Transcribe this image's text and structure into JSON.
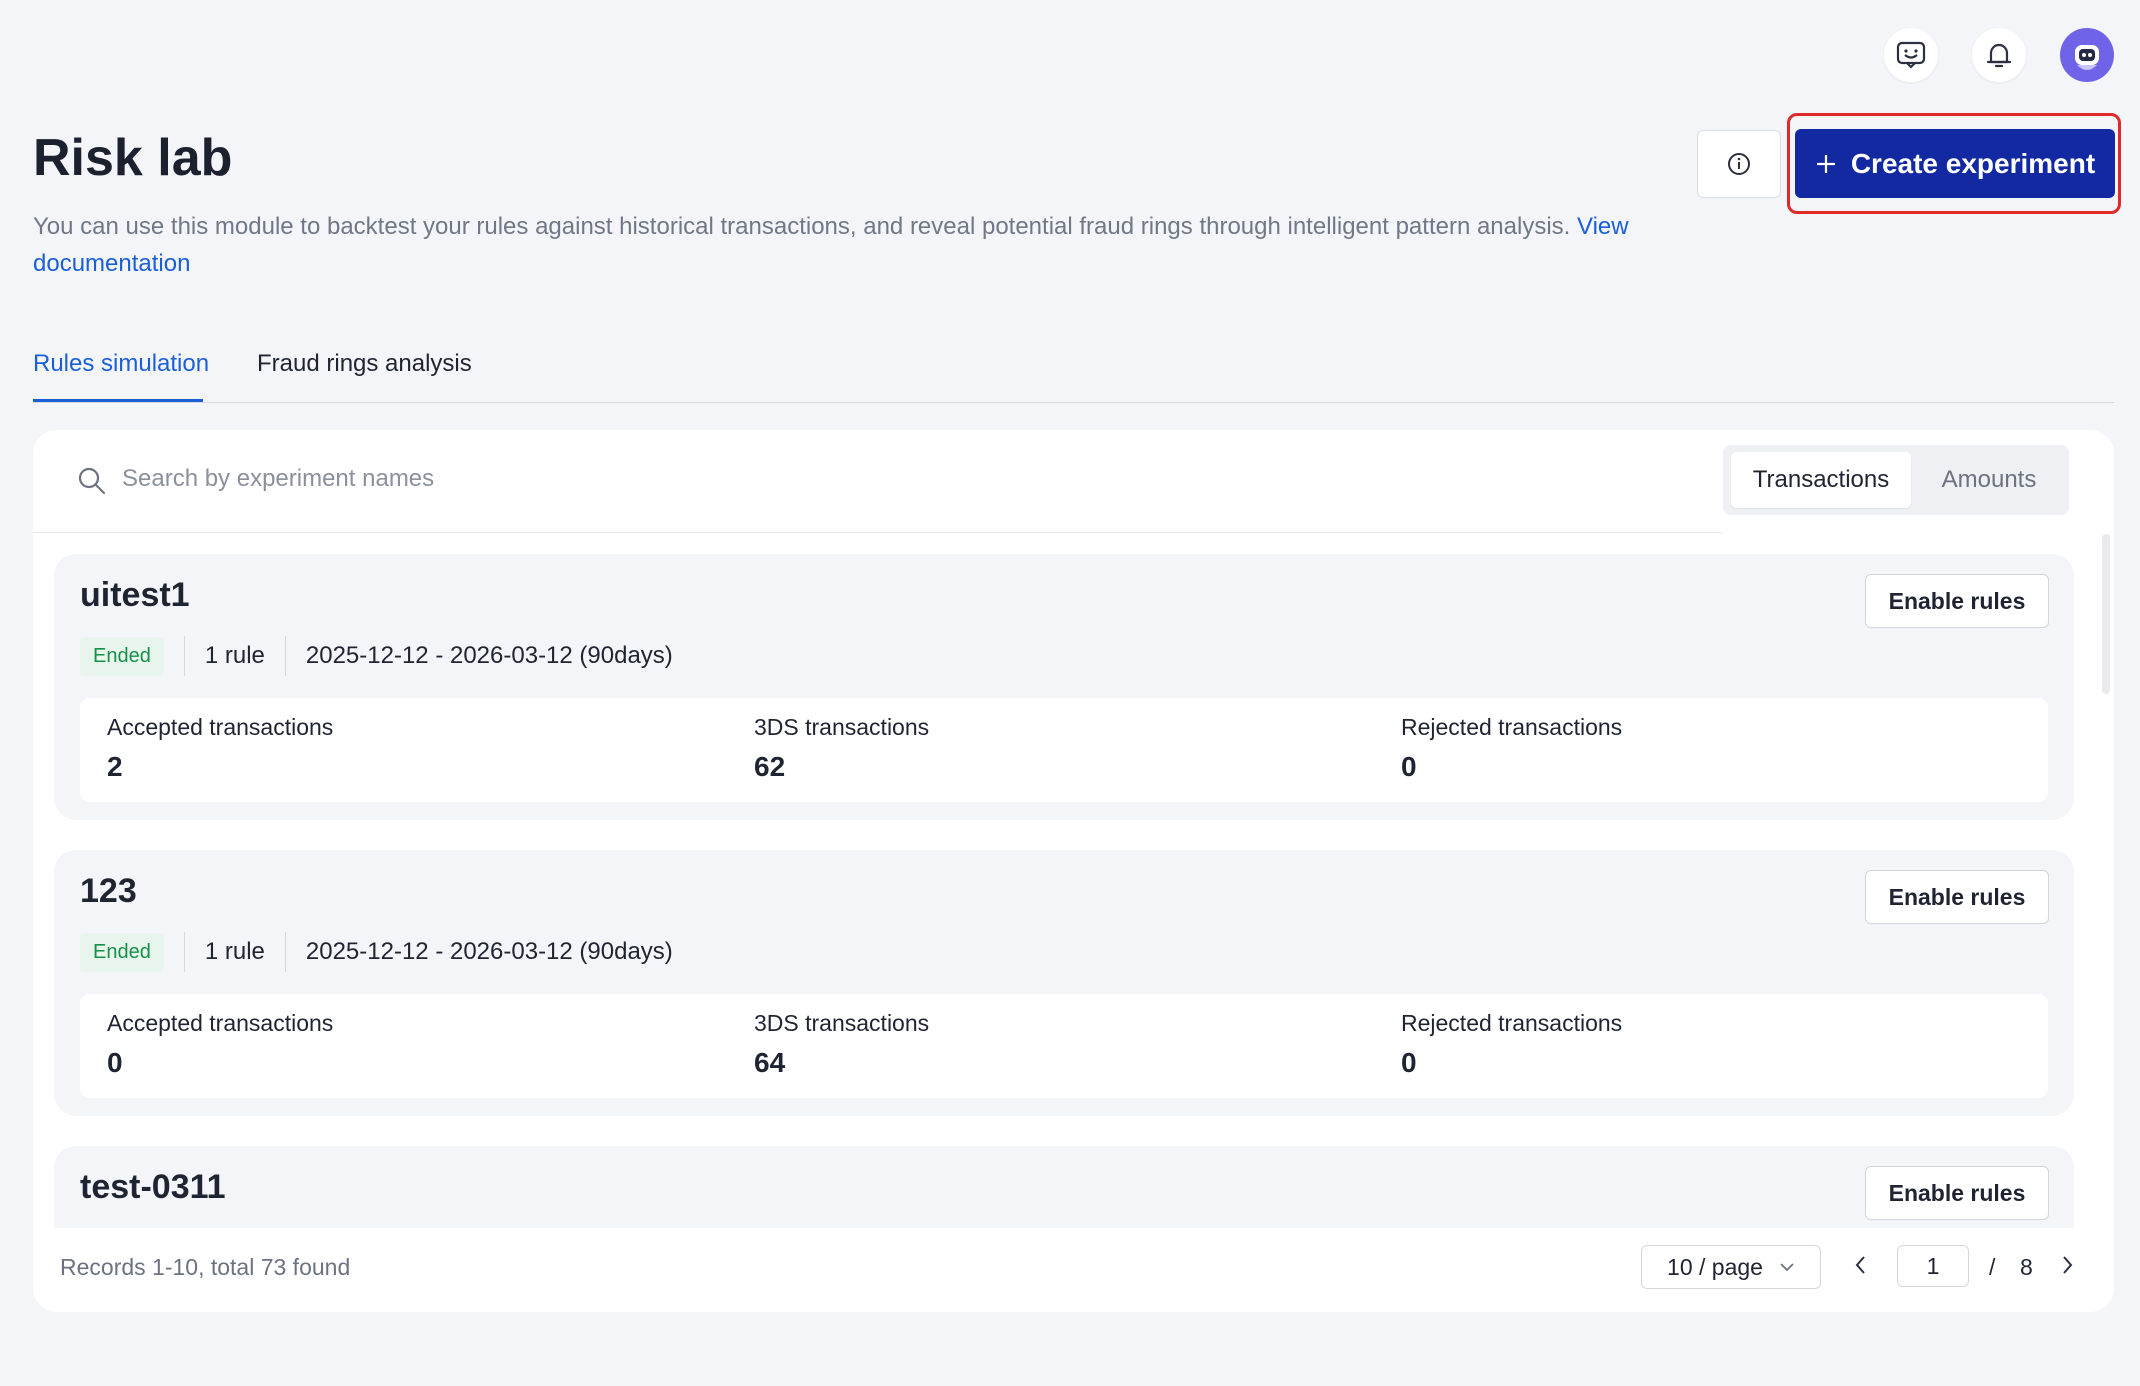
{
  "header": {
    "title": "Risk lab",
    "description": "You can use this module to backtest your rules against historical transactions, and reveal potential fraud rings through intelligent pattern analysis.",
    "doc_link": "View documentation",
    "create_button": "Create experiment",
    "icons": [
      "feedback-icon",
      "bell-icon",
      "avatar",
      "info-icon",
      "plus-icon"
    ]
  },
  "tabs": [
    {
      "label": "Rules simulation",
      "active": true
    },
    {
      "label": "Fraud rings analysis",
      "active": false
    }
  ],
  "search": {
    "placeholder": "Search by experiment names"
  },
  "view_toggle": {
    "options": [
      "Transactions",
      "Amounts"
    ],
    "selected": "Transactions"
  },
  "experiments": [
    {
      "name": "uitest1",
      "status": "Ended",
      "rules": "1 rule",
      "period": "2025-12-12 - 2026-03-12 (90days)",
      "action": "Enable rules",
      "stats": [
        {
          "label": "Accepted transactions",
          "value": "2"
        },
        {
          "label": "3DS transactions",
          "value": "62"
        },
        {
          "label": "Rejected transactions",
          "value": "0"
        }
      ]
    },
    {
      "name": "123",
      "status": "Ended",
      "rules": "1 rule",
      "period": "2025-12-12 - 2026-03-12 (90days)",
      "action": "Enable rules",
      "stats": [
        {
          "label": "Accepted transactions",
          "value": "0"
        },
        {
          "label": "3DS transactions",
          "value": "64"
        },
        {
          "label": "Rejected transactions",
          "value": "0"
        }
      ]
    },
    {
      "name": "test-0311",
      "action": "Enable rules"
    }
  ],
  "pagination": {
    "summary": "Records 1-10, total 73 found",
    "page_size": "10 / page",
    "current_page": "1",
    "separator": "/",
    "total_pages": "8"
  },
  "colors": {
    "primary": "#1229a2",
    "link": "#1a5fd6",
    "success": "#17914a",
    "highlight": "#e02a2a"
  }
}
